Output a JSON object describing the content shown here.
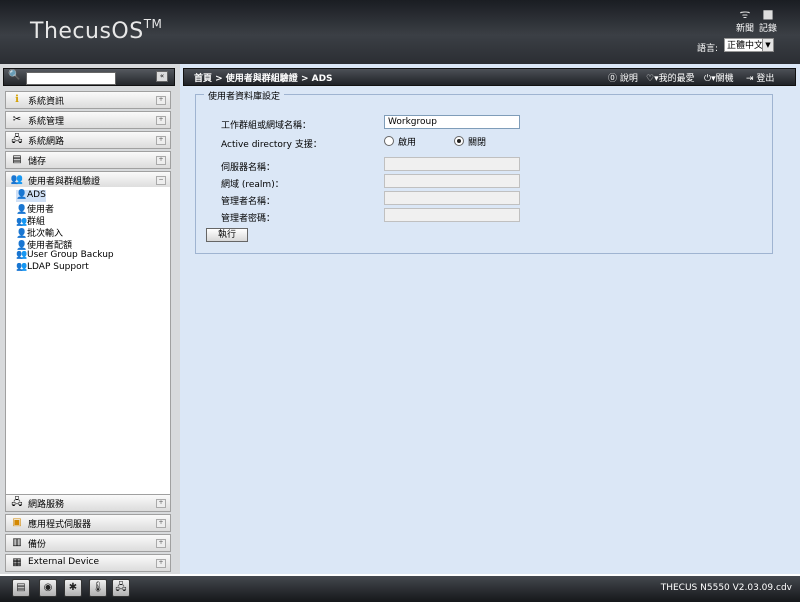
{
  "header": {
    "logo_text": "ThecusOS",
    "logo_tm": "TM",
    "rss_label": "新聞",
    "log_label": "記錄",
    "language_label": "語言:",
    "language_value": "正體中文"
  },
  "sidebar": {
    "search_placeholder": "",
    "items": [
      {
        "label": "系統資訊",
        "icon": "info-icon"
      },
      {
        "label": "系統管理",
        "icon": "tools-icon"
      },
      {
        "label": "系統網路",
        "icon": "network-icon"
      },
      {
        "label": "儲存",
        "icon": "storage-icon"
      },
      {
        "label": "使用者與群組驗證",
        "icon": "users-icon"
      }
    ],
    "subitems": [
      {
        "label": "ADS"
      },
      {
        "label": "使用者"
      },
      {
        "label": "群組"
      },
      {
        "label": "批次輸入"
      },
      {
        "label": "使用者配額"
      },
      {
        "label": "User Group Backup"
      },
      {
        "label": "LDAP Support"
      }
    ],
    "bottom_items": [
      {
        "label": "網路服務"
      },
      {
        "label": "應用程式伺服器"
      },
      {
        "label": "備份"
      },
      {
        "label": "External Device"
      }
    ]
  },
  "main": {
    "breadcrumb": "首頁 > 使用者與群組驗證 > ADS",
    "toolbar": {
      "help": "說明",
      "favorites": "我的最愛",
      "shutdown": "關機",
      "logout": "登出"
    },
    "form": {
      "legend": "使用者資料庫設定",
      "workgroup_label": "工作群組或網域名稱：",
      "workgroup_value": "Workgroup",
      "ad_label": "Active directory 支援：",
      "enable_label": "啟用",
      "disable_label": "關閉",
      "ad_selected": "disable",
      "server_label": "伺服器名稱：",
      "realm_label": "網域 (realm)：",
      "admin_label": "管理者名稱：",
      "password_label": "管理者密碼：",
      "apply_label": "執行"
    }
  },
  "footer": {
    "version": "THECUS N5550 V2.03.09.cdv"
  }
}
